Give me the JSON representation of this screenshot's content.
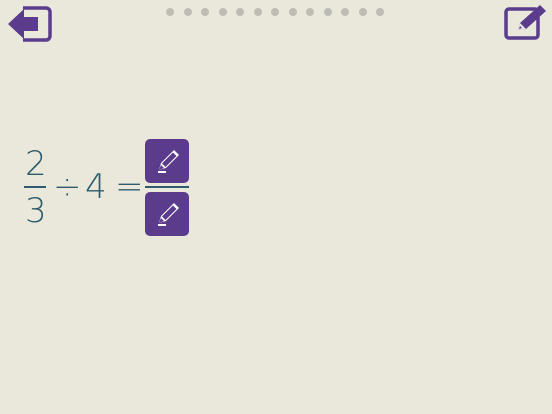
{
  "toolbar": {
    "back_icon": "back-arrow-icon",
    "edit_icon": "edit-note-icon",
    "accent_color": "#5b3b8c"
  },
  "progress": {
    "total": 13,
    "dot_color": "#bdbdb5"
  },
  "equation": {
    "left_numerator": "2",
    "left_denominator": "3",
    "operator": "÷",
    "divisor": "4",
    "equals": "=",
    "answer_numerator_icon": "pencil-icon",
    "answer_denominator_icon": "pencil-icon",
    "text_color": "#2c5b6b"
  }
}
